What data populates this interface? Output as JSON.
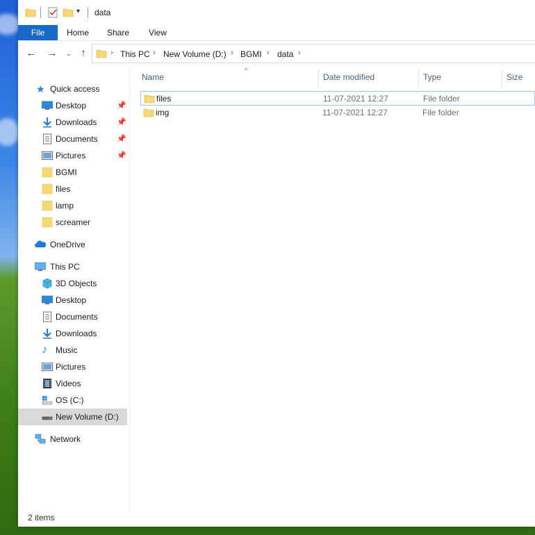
{
  "window": {
    "title": "data",
    "ribbon_tabs": [
      "File",
      "Home",
      "Share",
      "View"
    ]
  },
  "address": {
    "crumbs": [
      "This PC",
      "New Volume (D:)",
      "BGMI",
      "data"
    ]
  },
  "sidebar": {
    "quick_access": "Quick access",
    "quick_items": [
      "Desktop",
      "Downloads",
      "Documents",
      "Pictures",
      "BGMI",
      "files",
      "lamp",
      "screamer"
    ],
    "onedrive": "OneDrive",
    "this_pc": "This PC",
    "pc_items": [
      "3D Objects",
      "Desktop",
      "Documents",
      "Downloads",
      "Music",
      "Pictures",
      "Videos",
      "OS (C:)",
      "New Volume (D:)"
    ],
    "network": "Network"
  },
  "columns": {
    "name": "Name",
    "date": "Date modified",
    "type": "Type",
    "size": "Size"
  },
  "files": [
    {
      "name": "files",
      "date": "11-07-2021 12:27",
      "type": "File folder"
    },
    {
      "name": "img",
      "date": "11-07-2021 12:27",
      "type": "File folder"
    }
  ],
  "status": {
    "item_count": "2 items"
  },
  "colors": {
    "accent": "#1a68c7",
    "folder": "#f8d775",
    "selection": "#d9d9d9"
  }
}
